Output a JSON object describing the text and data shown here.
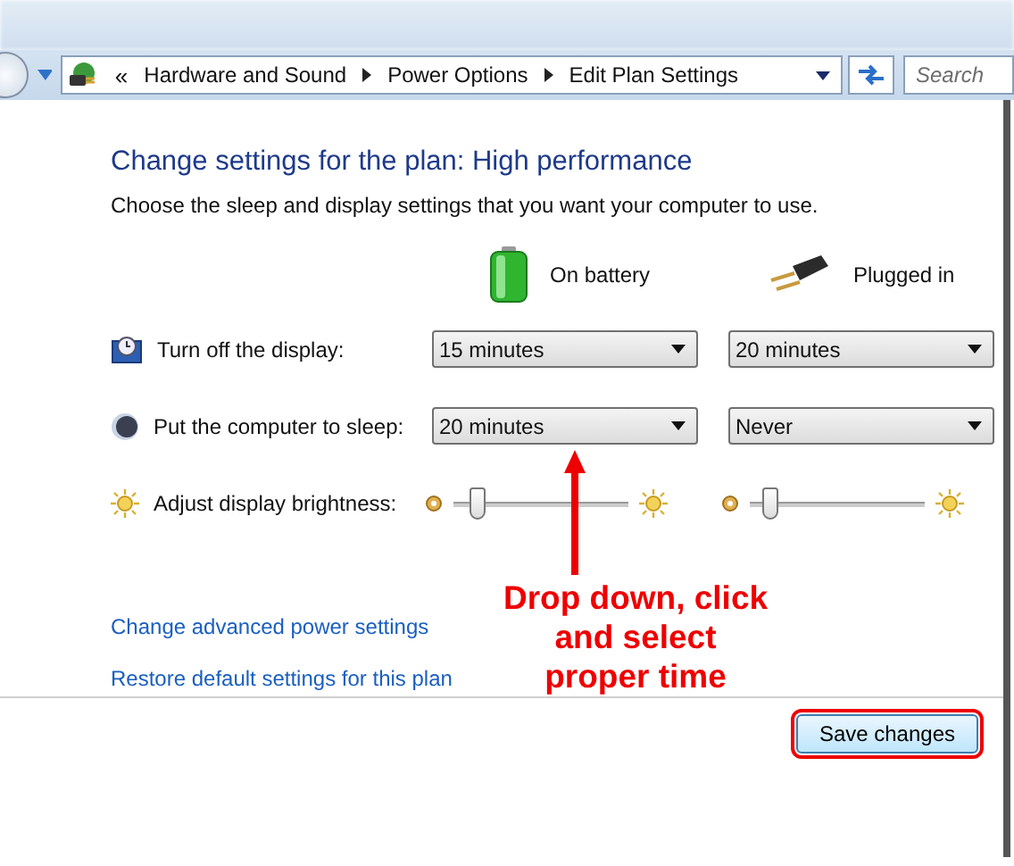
{
  "address_bar": {
    "overflow": "«",
    "crumbs": [
      "Hardware and Sound",
      "Power Options",
      "Edit Plan Settings"
    ]
  },
  "search": {
    "placeholder": "Search"
  },
  "heading": "Change settings for the plan: High performance",
  "subtitle": "Choose the sleep and display settings that you want your computer to use.",
  "columns": [
    {
      "label": "On battery",
      "kind": "battery"
    },
    {
      "label": "Plugged in",
      "kind": "plug"
    }
  ],
  "settings": [
    {
      "kind": "dropdown",
      "label": "Turn off the display:",
      "values": [
        "15 minutes",
        "20 minutes"
      ]
    },
    {
      "kind": "dropdown",
      "label": "Put the computer to sleep:",
      "values": [
        "20 minutes",
        "Never"
      ]
    },
    {
      "kind": "slider",
      "label": "Adjust display brightness:",
      "sliders": [
        {
          "level": 0.1
        },
        {
          "level": 0.08
        }
      ]
    }
  ],
  "links": [
    "Change advanced power settings",
    "Restore default settings for this plan"
  ],
  "annotation": {
    "lines": [
      "Drop down, click",
      "and select",
      "proper time"
    ]
  },
  "save_button": {
    "label": "Save changes",
    "highlighted": true
  }
}
